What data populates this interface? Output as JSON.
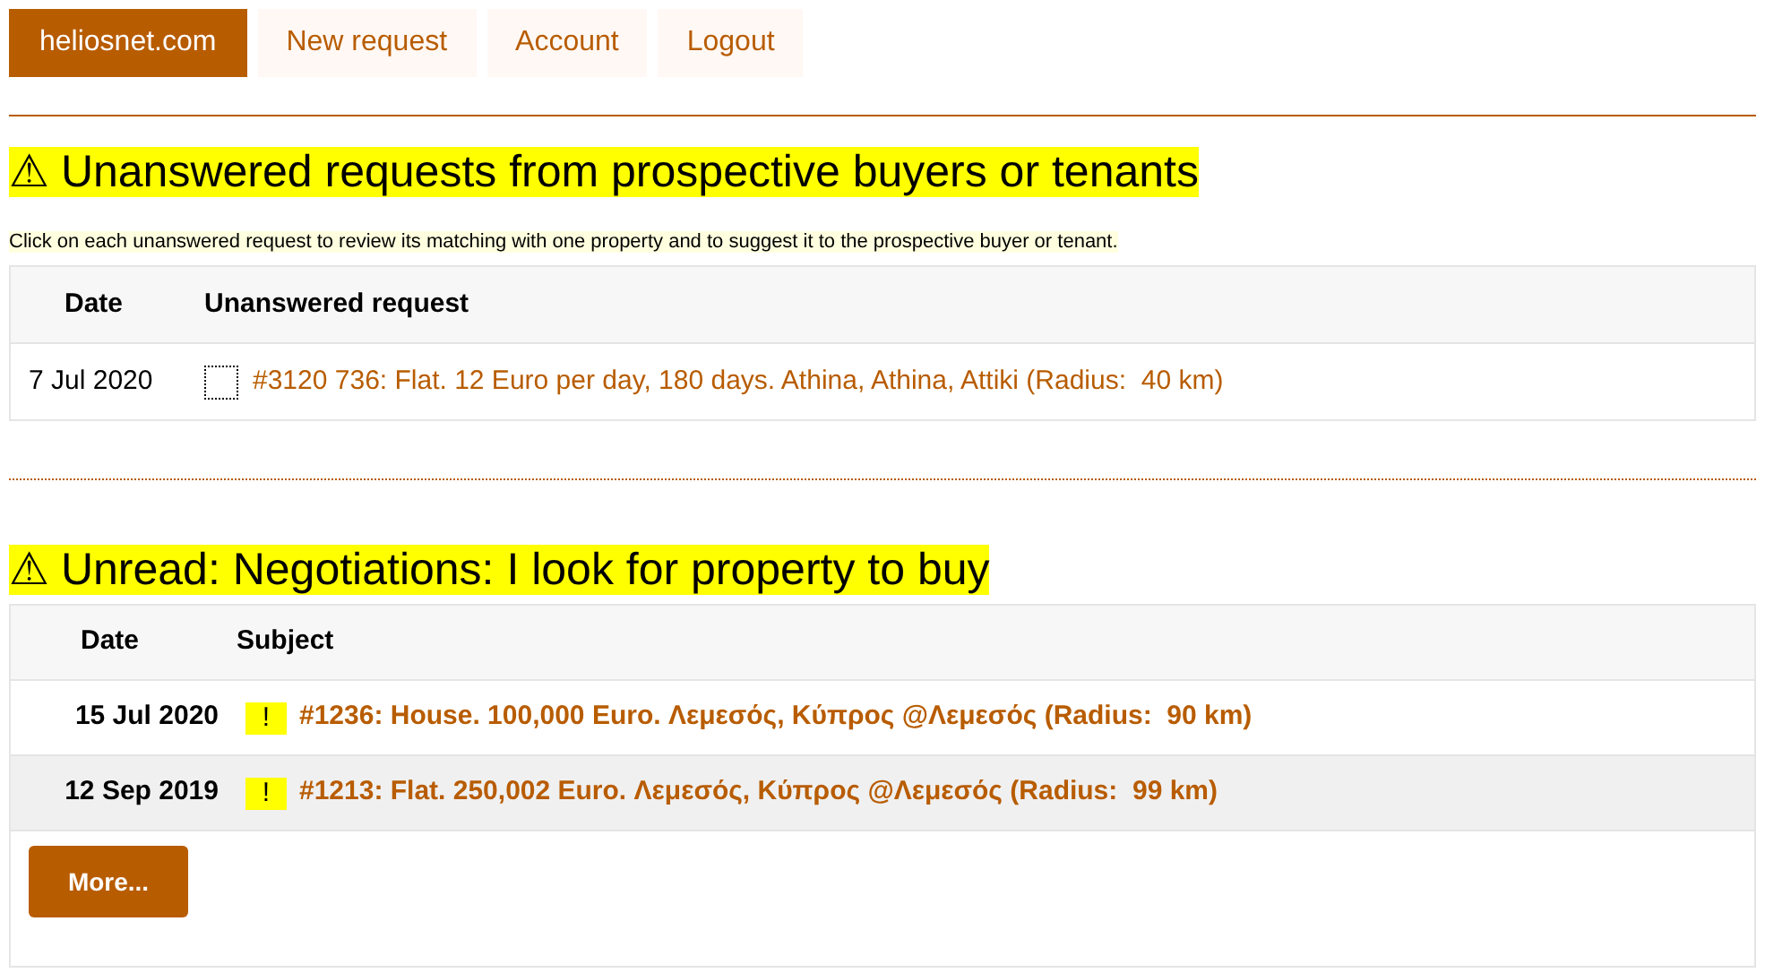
{
  "nav": [
    {
      "label": "heliosnet.com",
      "selected": true
    },
    {
      "label": "New request",
      "selected": false
    },
    {
      "label": "Account",
      "selected": false
    },
    {
      "label": "Logout",
      "selected": false
    }
  ],
  "requests_section": {
    "warning_icon": "⚠",
    "title": "Unanswered requests from prospective buyers or tenants",
    "note": "Click on each unanswered request to review its matching with one property and to suggest it to the prospective buyer or tenant.",
    "columns": [
      "Date",
      "Unanswered request"
    ],
    "rows": [
      {
        "date": "7 Jul 2020",
        "checked": false,
        "request": "#3120 736: Flat. 12 Euro per day, 180 days. Athina, Athina, Attiki (Radius:  40 km)"
      }
    ]
  },
  "negotiations_section": {
    "warning_icon": "⚠",
    "title": "Unread: Negotiations: I look for property to buy",
    "columns": [
      "Date",
      "Subject"
    ],
    "rows": [
      {
        "date": "15 Jul 2020",
        "unread_mark": "!",
        "subject": "#1236: House. 100,000 Euro. Λεμεσός, Κύπρος @Λεμεσός (Radius:  90 km)",
        "highlighted": false
      },
      {
        "date": "12 Sep 2019",
        "unread_mark": "!",
        "subject": "#1213: Flat. 250,002 Euro. Λεμεσός, Κύπρος @Λεμεσός (Radius:  99 km)",
        "highlighted": true
      }
    ],
    "more_button": "More..."
  }
}
